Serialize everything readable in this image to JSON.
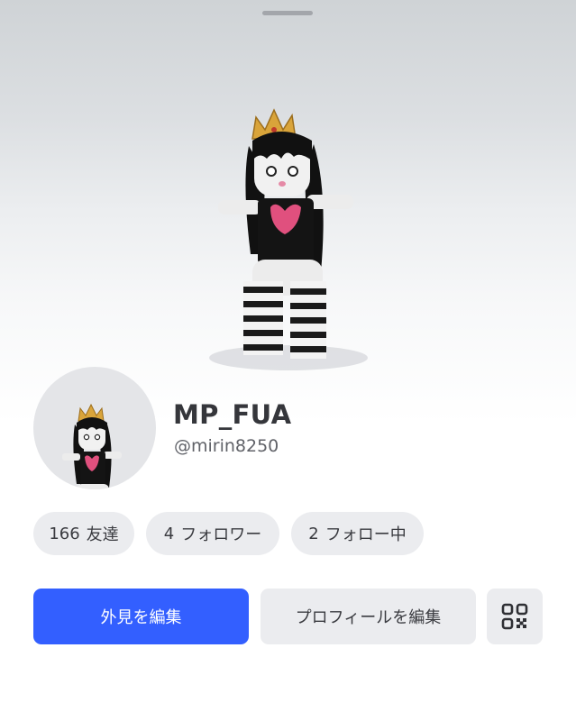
{
  "profile": {
    "display_name": "MP_FUA",
    "username": "@mirin8250"
  },
  "stats": {
    "friends": {
      "count": "166",
      "label": "友達"
    },
    "followers": {
      "count": "4",
      "label": "フォロワー"
    },
    "following": {
      "count": "2",
      "label": "フォロー中"
    }
  },
  "actions": {
    "edit_appearance": "外見を編集",
    "edit_profile": "プロフィールを編集",
    "qr_icon": "qr-code-icon"
  },
  "colors": {
    "primary_button": "#335fff",
    "secondary_button": "#ebecef",
    "text": "#3a3b40"
  }
}
